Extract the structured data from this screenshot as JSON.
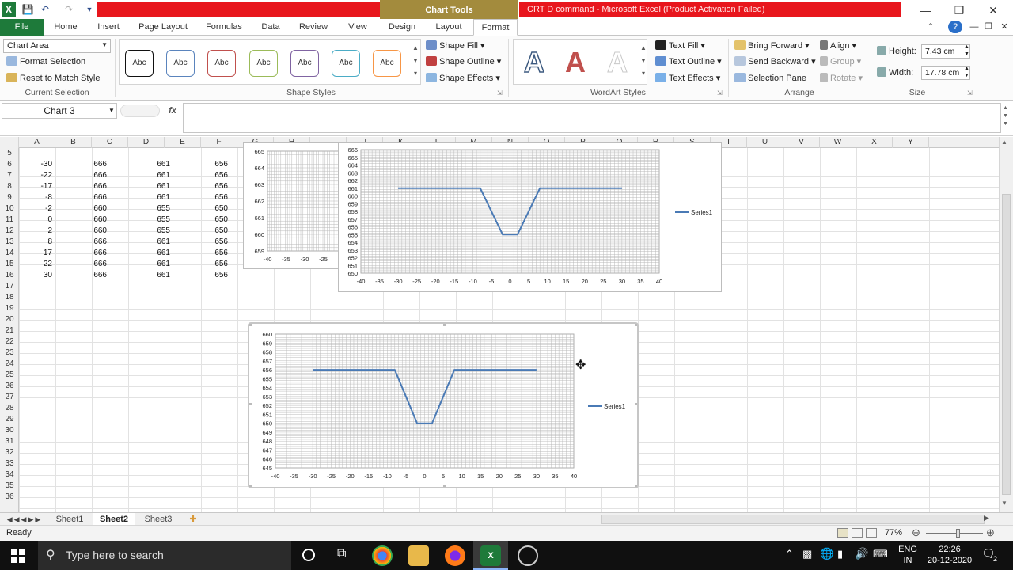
{
  "title": {
    "chart_tools": "Chart Tools",
    "window_title": "CRT D command  -  Microsoft Excel (Product Activation Failed)"
  },
  "tabs": [
    "File",
    "Home",
    "Insert",
    "Page Layout",
    "Formulas",
    "Data",
    "Review",
    "View",
    "Design",
    "Layout",
    "Format"
  ],
  "ribbon": {
    "current_selection": {
      "dropdown_value": "Chart Area",
      "format_selection": "Format Selection",
      "reset_to_match_style": "Reset to Match Style",
      "label": "Current Selection"
    },
    "shape_styles": {
      "swatch_label": "Abc",
      "shape_fill": "Shape Fill",
      "shape_outline": "Shape Outline",
      "shape_effects": "Shape Effects",
      "label": "Shape Styles"
    },
    "wordart": {
      "glyph": "A",
      "text_fill": "Text Fill",
      "text_outline": "Text Outline",
      "text_effects": "Text Effects",
      "label": "WordArt Styles"
    },
    "arrange": {
      "bring_forward": "Bring Forward",
      "send_backward": "Send Backward",
      "selection_pane": "Selection Pane",
      "align": "Align",
      "group": "Group",
      "rotate": "Rotate",
      "label": "Arrange"
    },
    "size": {
      "height_label": "Height:",
      "height_value": "7.43 cm",
      "width_label": "Width:",
      "width_value": "17.78 cm",
      "label": "Size"
    }
  },
  "formula_bar": {
    "name_box": "Chart 3",
    "fx": "fx"
  },
  "columns": [
    "A",
    "B",
    "C",
    "D",
    "E",
    "F",
    "G",
    "H",
    "I",
    "J",
    "K",
    "L",
    "M",
    "N",
    "O",
    "P",
    "Q",
    "R",
    "S",
    "T",
    "U",
    "V",
    "W",
    "X",
    "Y"
  ],
  "rows": [
    "5",
    "6",
    "7",
    "8",
    "9",
    "10",
    "11",
    "12",
    "13",
    "14",
    "15",
    "16",
    "17",
    "18",
    "19",
    "20",
    "21",
    "22",
    "23",
    "24",
    "25",
    "26",
    "27",
    "28",
    "29",
    "30",
    "31",
    "32",
    "33",
    "34",
    "35",
    "36"
  ],
  "table": [
    [
      "-30",
      "666",
      "661",
      "656"
    ],
    [
      "-22",
      "666",
      "661",
      "656"
    ],
    [
      "-17",
      "666",
      "661",
      "656"
    ],
    [
      "-8",
      "666",
      "661",
      "656"
    ],
    [
      "-2",
      "660",
      "655",
      "650"
    ],
    [
      "0",
      "660",
      "655",
      "650"
    ],
    [
      "2",
      "660",
      "655",
      "650"
    ],
    [
      "8",
      "666",
      "661",
      "656"
    ],
    [
      "17",
      "666",
      "661",
      "656"
    ],
    [
      "22",
      "666",
      "661",
      "656"
    ],
    [
      "30",
      "666",
      "661",
      "656"
    ]
  ],
  "chart_data": [
    {
      "type": "line",
      "name": "Chart 1 (partially hidden)",
      "yticks": [
        "665",
        "664",
        "663",
        "662",
        "661",
        "660",
        "659"
      ],
      "xticks": [
        "-40",
        "-35",
        "-30",
        "-25",
        "-"
      ],
      "ylim": [
        659,
        665
      ]
    },
    {
      "type": "line",
      "x": [
        -30,
        -22,
        -17,
        -8,
        -2,
        0,
        2,
        8,
        17,
        22,
        30
      ],
      "series": [
        {
          "name": "Series1",
          "values": [
            661,
            661,
            661,
            661,
            655,
            655,
            655,
            661,
            661,
            661,
            661
          ]
        }
      ],
      "yticks": [
        "666",
        "665",
        "664",
        "663",
        "662",
        "661",
        "660",
        "659",
        "658",
        "657",
        "656",
        "655",
        "654",
        "653",
        "652",
        "651",
        "650"
      ],
      "xticks": [
        "-40",
        "-35",
        "-30",
        "-25",
        "-20",
        "-15",
        "-10",
        "-5",
        "0",
        "5",
        "10",
        "15",
        "20",
        "25",
        "30",
        "35",
        "40"
      ],
      "xlim": [
        -40,
        40
      ],
      "ylim": [
        650,
        666
      ],
      "grid": true,
      "legend": "right"
    },
    {
      "type": "line",
      "x": [
        -30,
        -22,
        -17,
        -8,
        -2,
        0,
        2,
        8,
        17,
        22,
        30
      ],
      "series": [
        {
          "name": "Series1",
          "values": [
            656,
            656,
            656,
            656,
            650,
            650,
            650,
            656,
            656,
            656,
            656
          ]
        }
      ],
      "yticks": [
        "660",
        "659",
        "658",
        "657",
        "656",
        "655",
        "654",
        "653",
        "652",
        "651",
        "650",
        "649",
        "648",
        "647",
        "646",
        "645"
      ],
      "xticks": [
        "-40",
        "-35",
        "-30",
        "-25",
        "-20",
        "-15",
        "-10",
        "-5",
        "0",
        "5",
        "10",
        "15",
        "20",
        "25",
        "30",
        "35",
        "40"
      ],
      "xlim": [
        -40,
        40
      ],
      "ylim": [
        645,
        660
      ],
      "grid": true,
      "legend": "right"
    }
  ],
  "sheets": [
    "Sheet1",
    "Sheet2",
    "Sheet3"
  ],
  "status": {
    "ready": "Ready",
    "zoom": "77%"
  },
  "taskbar": {
    "search_placeholder": "Type here to search",
    "lang1": "ENG",
    "lang2": "IN",
    "time": "22:26",
    "date": "20-12-2020",
    "notif_count": "2"
  },
  "colors": {
    "file_tab": "#1e7a3a",
    "series_line": "#4a7ab5",
    "title_red": "#e8161d"
  }
}
